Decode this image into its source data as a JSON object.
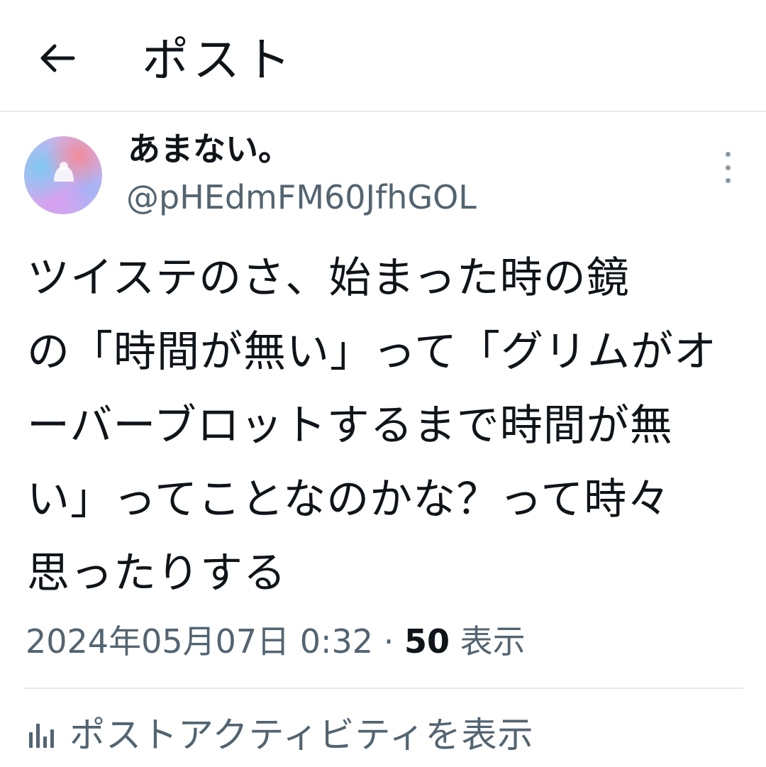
{
  "header": {
    "title": "ポスト",
    "back_icon": "arrow-left-icon"
  },
  "author": {
    "display_name": "あまない。",
    "handle": "@pHEdmFM60JfhGOL",
    "more_icon": "more-vertical-icon"
  },
  "post": {
    "lines": [
      "ツイステのさ、始まった時の鏡",
      "の「時間が無い」って「グリムがオ",
      "ーバーブロットするまで時間が無",
      "い」ってことなのかな？って時々",
      "思ったりする"
    ]
  },
  "meta": {
    "timestamp": "2024年05月07日 0:32",
    "separator": "·",
    "view_count": "50",
    "view_label": "表示"
  },
  "activity": {
    "label": "ポストアクティビティを表示",
    "icon": "analytics-bars-icon"
  },
  "colors": {
    "text_primary": "#0f1419",
    "text_secondary": "#536471",
    "divider": "#e7e9ea"
  }
}
